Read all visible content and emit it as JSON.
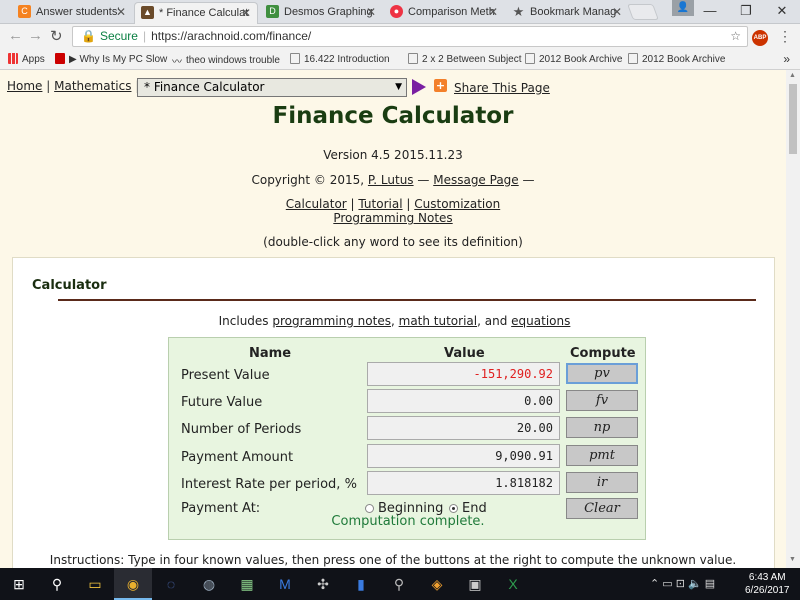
{
  "browser": {
    "tabs": [
      {
        "title": "Answer students'",
        "icon": "chegg-icon",
        "active": false
      },
      {
        "title": "* Finance Calculat",
        "icon": "arachnoid-icon",
        "active": true
      },
      {
        "title": "Desmos Graphing",
        "icon": "desmos-icon",
        "active": false
      },
      {
        "title": "Comparison Meth",
        "icon": "circle-icon",
        "active": false
      },
      {
        "title": "Bookmark Manag",
        "icon": "star-icon",
        "active": false
      }
    ],
    "secure_label": "Secure",
    "url": "https://arachnoid.com/finance/",
    "bookmarks": [
      "Apps",
      "Why Is My PC Slow",
      "theo windows trouble",
      "16.422 Introduction",
      "2 x 2 Between Subject",
      "2012 Book Archive",
      "2012 Book Archive"
    ],
    "abp_label": "ABP"
  },
  "page": {
    "nav": {
      "home": "Home",
      "sep1": "|",
      "mathematics": "Mathematics",
      "sep2": "|"
    },
    "select_value": "* Finance Calculator",
    "share_label": "Share This Page",
    "title": "Finance Calculator",
    "version": "Version 4.5 2015.11.23",
    "copyright_prefix": "Copyright © 2015,",
    "author": "P. Lutus",
    "dash1": "—",
    "message_page": "Message Page",
    "dash2": "—",
    "links": {
      "calculator": "Calculator",
      "tutorial": "Tutorial",
      "customization": "Customization",
      "programming_notes": "Programming Notes",
      "sep": "|"
    },
    "dblclick_hint": "(double-click any word to see its definition)",
    "instructions": "Instructions: Type in four known values, then press one of the buttons at the right to compute the unknown value."
  },
  "calculator": {
    "heading": "Calculator",
    "includes_prefix": "Includes",
    "includes_links": [
      "programming notes",
      "math tutorial",
      "equations"
    ],
    "includes_sep1": ",",
    "includes_and": ", and",
    "headers": {
      "name": "Name",
      "value": "Value",
      "compute": "Compute"
    },
    "rows": [
      {
        "label": "Present Value",
        "value": "-151,290.92",
        "button": "pv"
      },
      {
        "label": "Future Value",
        "value": "0.00",
        "button": "fv"
      },
      {
        "label": "Number of Periods",
        "value": "20.00",
        "button": "np"
      },
      {
        "label": "Payment Amount",
        "value": "9,090.91",
        "button": "pmt"
      },
      {
        "label": "Interest Rate per period, %",
        "value": "1.818182",
        "button": "ir"
      }
    ],
    "payment_at_label": "Payment At:",
    "payment_options": [
      "Beginning",
      "End"
    ],
    "payment_selected": "End",
    "clear_label": "Clear",
    "status": "Computation complete."
  },
  "taskbar": {
    "time": "6:43 AM",
    "date": "6/26/2017"
  },
  "colors": {
    "page_bg": "#fdf8e8",
    "title": "#1a3d12",
    "calc_bg": "#e8f5e0",
    "status": "#1f7a3a",
    "negative": "#e02020"
  }
}
